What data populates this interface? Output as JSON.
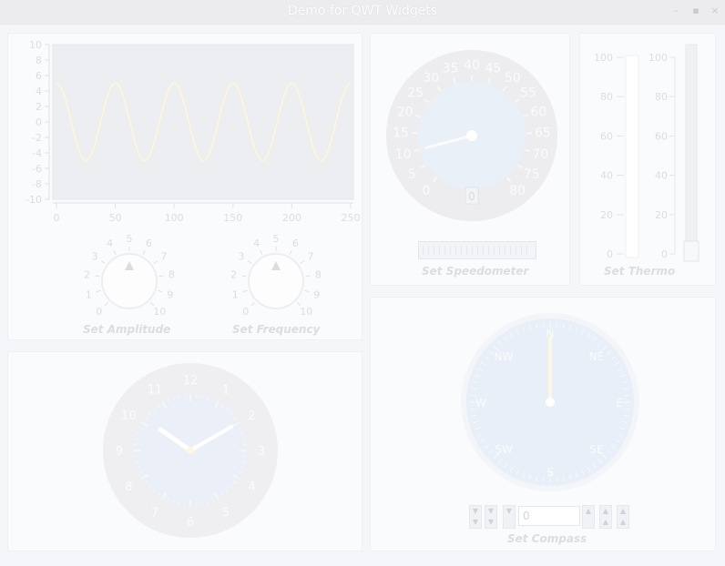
{
  "window": {
    "title": "Demo for QWT Widgets",
    "buttons": {
      "minimize": "–",
      "maximize": "▪",
      "close": "×"
    }
  },
  "plot": {
    "y_ticks": [
      "10",
      "8",
      "6",
      "4",
      "2",
      "0",
      "-2",
      "-4",
      "-6",
      "-8",
      "-10"
    ],
    "x_ticks": [
      "0",
      "50",
      "100",
      "150",
      "200",
      "250"
    ]
  },
  "chart_data": {
    "type": "line",
    "series": [
      {
        "amplitude": 5,
        "cycles": 5,
        "x_range": [
          0,
          250
        ]
      }
    ],
    "xlim": [
      0,
      250
    ],
    "ylim": [
      -10,
      10
    ],
    "grid": false
  },
  "amplitude_knob": {
    "caption": "Set Amplitude",
    "scale": [
      "0",
      "1",
      "2",
      "3",
      "4",
      "5",
      "6",
      "7",
      "8",
      "9",
      "10"
    ],
    "value": 5
  },
  "frequency_knob": {
    "caption": "Set Frequency",
    "scale": [
      "0",
      "1",
      "2",
      "3",
      "4",
      "5",
      "6",
      "7",
      "8",
      "9",
      "10"
    ],
    "value": 5
  },
  "speedometer": {
    "caption": "Set Speedometer",
    "scale": [
      "0",
      "5",
      "10",
      "15",
      "20",
      "25",
      "30",
      "35",
      "40",
      "45",
      "50",
      "55",
      "60",
      "65",
      "70",
      "75",
      "80"
    ],
    "value": 10,
    "readout": "0"
  },
  "thermo": {
    "caption": "Set Thermo",
    "left_scale": [
      "100",
      "80",
      "60",
      "40",
      "20",
      "0"
    ],
    "right_scale": [
      "100",
      "80",
      "60",
      "40",
      "20",
      "0"
    ],
    "value": 0
  },
  "clock": {
    "numbers": [
      "12",
      "1",
      "2",
      "3",
      "4",
      "5",
      "6",
      "7",
      "8",
      "9",
      "10",
      "11"
    ],
    "hour": 10,
    "minute": 10
  },
  "compass": {
    "caption": "Set Compass",
    "labels": [
      "N",
      "NE",
      "E",
      "SE",
      "S",
      "SW",
      "W",
      "NW"
    ],
    "value": "0"
  }
}
